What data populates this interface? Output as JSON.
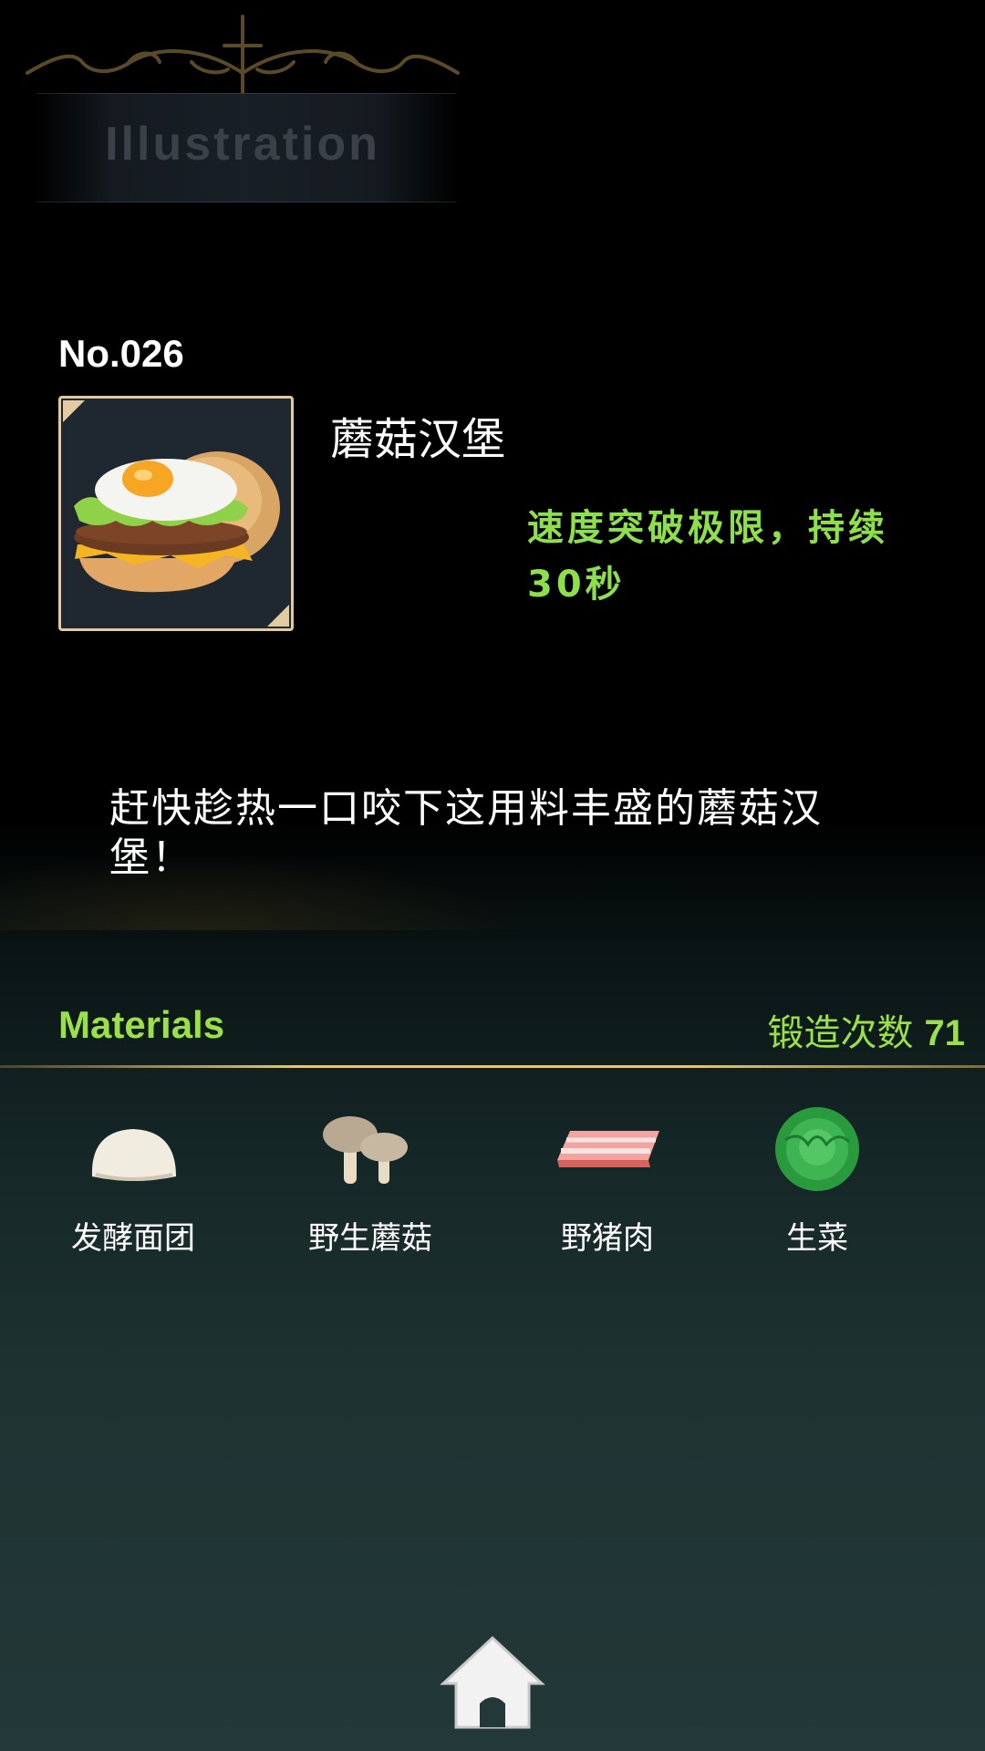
{
  "header": {
    "title": "Illustration"
  },
  "item": {
    "number": "No.026",
    "name": "蘑菇汉堡",
    "effect": "速度突破极限，持续30秒",
    "description": "赶快趁热一口咬下这用料丰盛的蘑菇汉堡！",
    "icon": "burger-icon"
  },
  "materials": {
    "title": "Materials",
    "forge_label": "锻造次数",
    "forge_count": "71",
    "items": [
      {
        "label": "发酵面团",
        "icon": "dough-icon"
      },
      {
        "label": "野生蘑菇",
        "icon": "mushroom-icon"
      },
      {
        "label": "野猪肉",
        "icon": "bacon-icon"
      },
      {
        "label": "生菜",
        "icon": "lettuce-icon"
      }
    ]
  },
  "nav": {
    "home_icon": "home-icon"
  },
  "colors": {
    "accent_green": "#8ee04a",
    "frame_gold": "#e3caa0",
    "divider_gold": "#e8c47a",
    "banner_text": "#3a4148"
  }
}
